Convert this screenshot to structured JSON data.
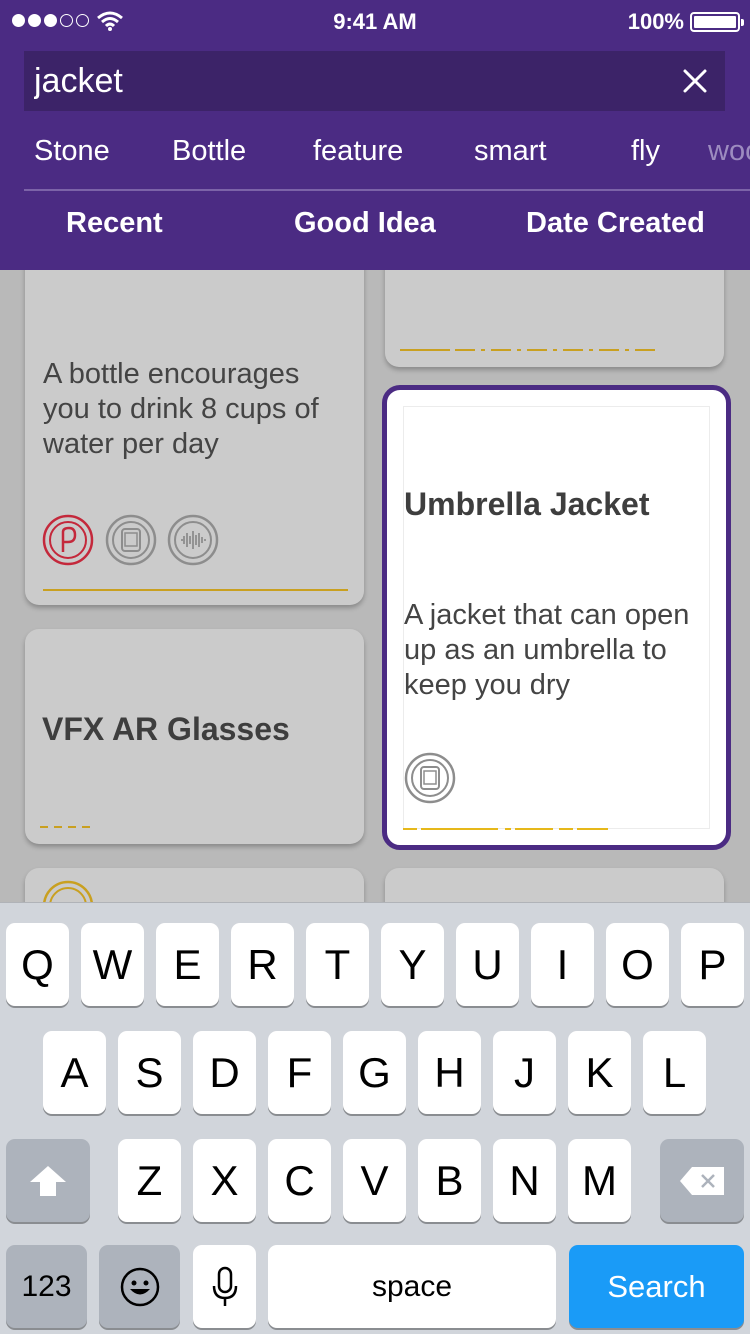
{
  "status_bar": {
    "time": "9:41 AM",
    "battery": "100%"
  },
  "search": {
    "query": "jacket"
  },
  "tags": [
    "Stone",
    "Bottle",
    "feature",
    "smart",
    "fly",
    "woo"
  ],
  "sort_options": [
    "Recent",
    "Good Idea",
    "Date Created"
  ],
  "cards": {
    "bottle": {
      "description": "A bottle encourages you to drink 8 cups of water per day"
    },
    "umbrella": {
      "title": "Umbrella Jacket",
      "description": "A jacket that can open up as an umbrella to keep you dry"
    },
    "vfx": {
      "title": "VFX AR Glasses"
    }
  },
  "colors": {
    "header": "#4b2b83",
    "accent_line": "#c9a020",
    "search_key": "#1a9bf7"
  },
  "keyboard": {
    "row1": [
      "Q",
      "W",
      "E",
      "R",
      "T",
      "Y",
      "U",
      "I",
      "O",
      "P"
    ],
    "row2": [
      "A",
      "S",
      "D",
      "F",
      "G",
      "H",
      "J",
      "K",
      "L"
    ],
    "row3": [
      "Z",
      "X",
      "C",
      "V",
      "B",
      "N",
      "M"
    ],
    "numbers_label": "123",
    "space_label": "space",
    "search_label": "Search"
  }
}
